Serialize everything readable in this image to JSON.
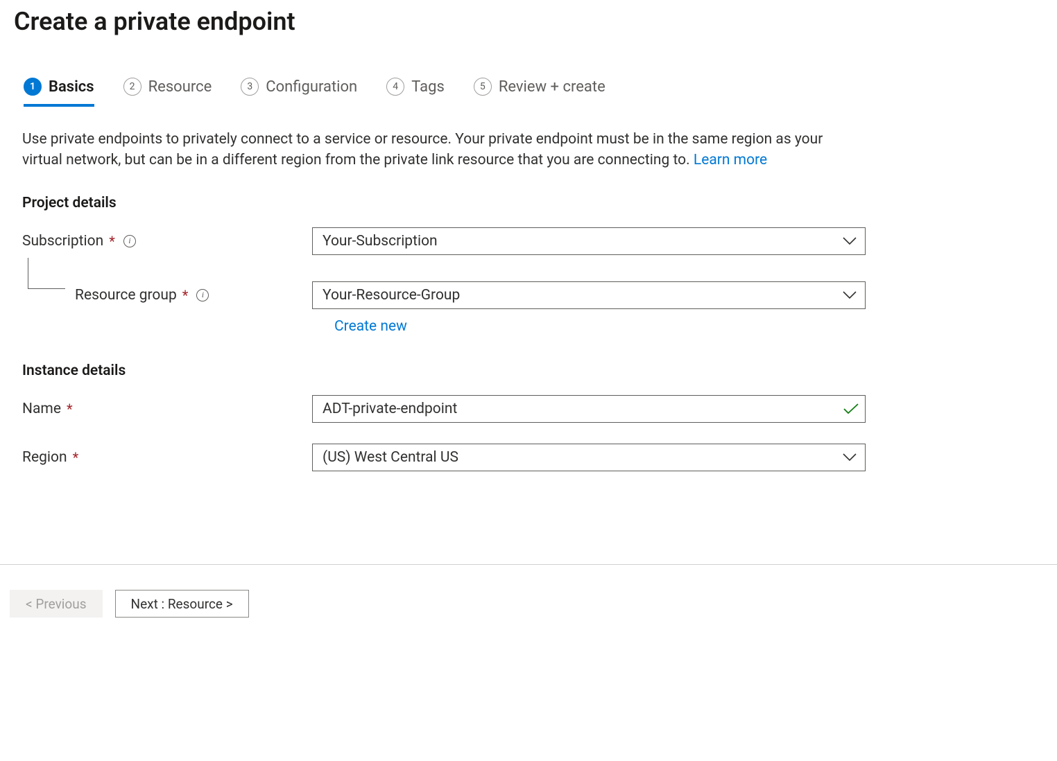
{
  "page_title": "Create a private endpoint",
  "tabs": [
    {
      "num": "1",
      "label": "Basics",
      "active": true
    },
    {
      "num": "2",
      "label": "Resource",
      "active": false
    },
    {
      "num": "3",
      "label": "Configuration",
      "active": false
    },
    {
      "num": "4",
      "label": "Tags",
      "active": false
    },
    {
      "num": "5",
      "label": "Review + create",
      "active": false
    }
  ],
  "description_text": "Use private endpoints to privately connect to a service or resource. Your private endpoint must be in the same region as your virtual network, but can be in a different region from the private link resource that you are connecting to.  ",
  "learn_more_label": "Learn more",
  "sections": {
    "project_details_title": "Project details",
    "instance_details_title": "Instance details"
  },
  "fields": {
    "subscription": {
      "label": "Subscription",
      "value": "Your-Subscription"
    },
    "resource_group": {
      "label": "Resource group",
      "value": "Your-Resource-Group",
      "create_new_label": "Create new"
    },
    "name": {
      "label": "Name",
      "value": "ADT-private-endpoint"
    },
    "region": {
      "label": "Region",
      "value": "(US) West Central US"
    }
  },
  "footer": {
    "previous_label": "< Previous",
    "next_label": "Next : Resource >"
  }
}
